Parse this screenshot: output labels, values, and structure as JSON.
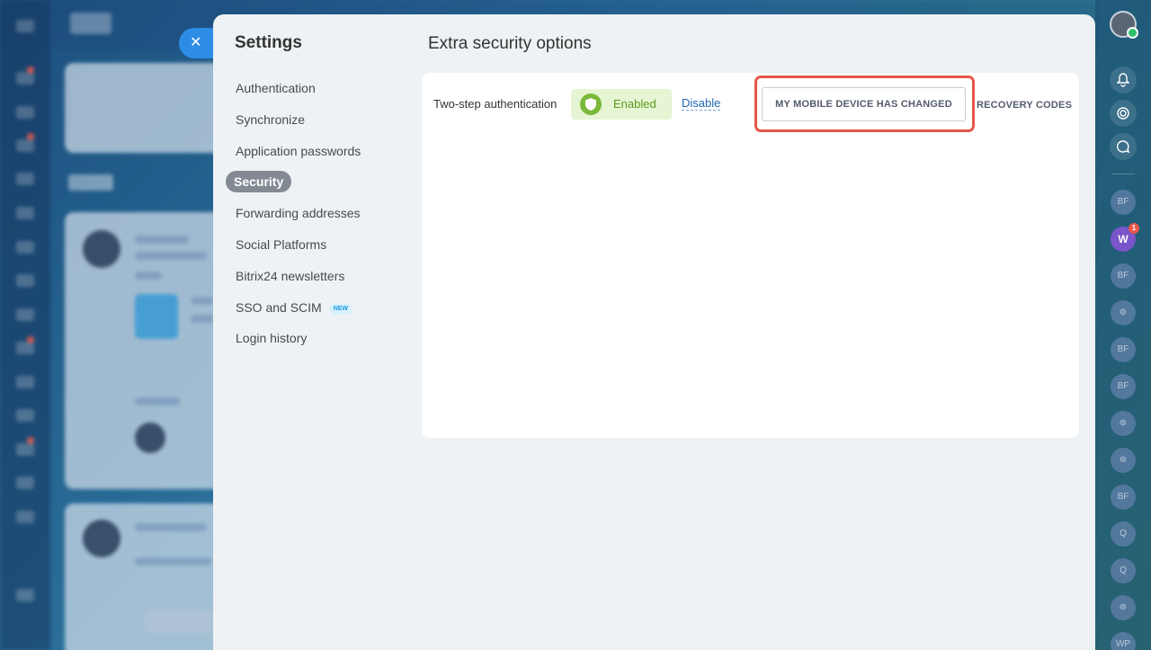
{
  "settings": {
    "title": "Settings",
    "close_label": "✕",
    "nav": [
      {
        "label": "Authentication"
      },
      {
        "label": "Synchronize"
      },
      {
        "label": "Application passwords"
      },
      {
        "label": "Security",
        "active": true
      },
      {
        "label": "Forwarding addresses"
      },
      {
        "label": "Social Platforms"
      },
      {
        "label": "Bitrix24 newsletters"
      },
      {
        "label": "SSO and SCIM",
        "badge": "NEW"
      },
      {
        "label": "Login history"
      }
    ]
  },
  "security": {
    "title": "Extra security options",
    "two_step_label": "Two-step authentication",
    "status": "Enabled",
    "disable_label": "Disable",
    "device_changed_button": "MY MOBILE DEVICE HAS CHANGED",
    "recovery_codes_label": "RECOVERY CODES"
  },
  "rightbar": {
    "notification_badge": "1",
    "chats": [
      "BF",
      "W",
      "BF",
      "",
      "BF",
      "BF",
      "",
      "",
      "BF",
      "Q",
      "Q",
      "",
      "WP"
    ]
  },
  "colors": {
    "accent": "#2d8ce6",
    "enabled_bg": "#e6f5d3",
    "enabled_text": "#5b9a1e",
    "highlight": "#e7564a",
    "active_nav": "#838a93"
  }
}
